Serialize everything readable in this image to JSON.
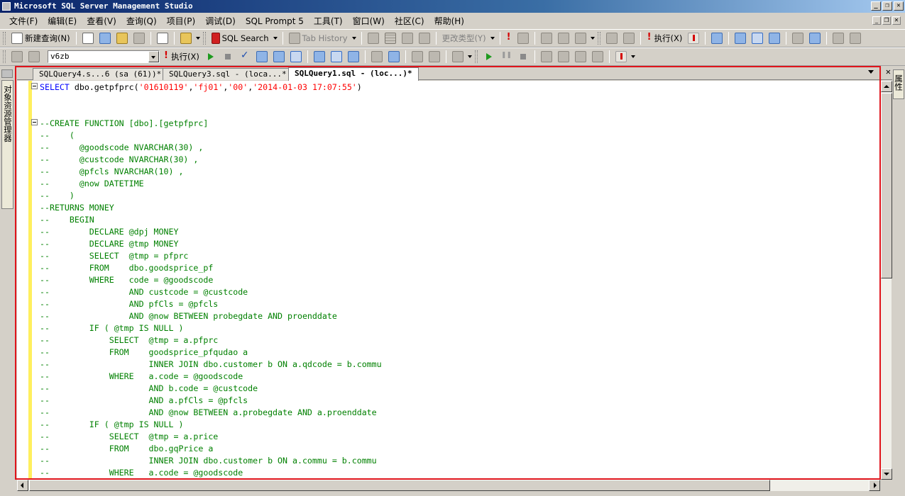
{
  "window": {
    "title": "Microsoft SQL Server Management Studio"
  },
  "menu": [
    "文件(F)",
    "编辑(E)",
    "查看(V)",
    "查询(Q)",
    "项目(P)",
    "调试(D)",
    "SQL Prompt 5",
    "工具(T)",
    "窗口(W)",
    "社区(C)",
    "帮助(H)"
  ],
  "toolbar1": {
    "new_query": "新建查询(N)",
    "sql_search": "SQL Search",
    "tab_history": "Tab History",
    "change_type": "更改类型(Y)",
    "execute": "执行(X)"
  },
  "toolbar2": {
    "database": "v6zb",
    "execute": "执行(X)"
  },
  "side_panels": {
    "left": "对象资源管理器",
    "right": "属性"
  },
  "tabs": [
    {
      "label": "SQLQuery4.s...6 (sa (61))*",
      "active": false
    },
    {
      "label": "SQLQuery3.sql - (loca...*",
      "active": false
    },
    {
      "label": "SQLQuery1.sql - (loc...)*",
      "active": true
    }
  ],
  "editor": {
    "lines": [
      "SELECT dbo.getpfprc('01610119','fj01','00','2014-01-03 17:07:55')",
      "",
      "",
      "--CREATE FUNCTION [dbo].[getpfprc]",
      "--    (",
      "--      @goodscode NVARCHAR(30) ,",
      "--      @custcode NVARCHAR(30) ,",
      "--      @pfcls NVARCHAR(10) ,",
      "--      @now DATETIME",
      "--    )",
      "--RETURNS MONEY",
      "--    BEGIN",
      "--        DECLARE @dpj MONEY",
      "--        DECLARE @tmp MONEY",
      "--        SELECT  @tmp = pfprc",
      "--        FROM    dbo.goodsprice_pf",
      "--        WHERE   code = @goodscode",
      "--                AND custcode = @custcode",
      "--                AND pfCls = @pfcls",
      "--                AND @now BETWEEN probegdate AND proenddate",
      "--        IF ( @tmp IS NULL )",
      "--            SELECT  @tmp = a.pfprc",
      "--            FROM    goodsprice_pfqudao a",
      "--                    INNER JOIN dbo.customer b ON a.qdcode = b.commu",
      "--            WHERE   a.code = @goodscode",
      "--                    AND b.code = @custcode",
      "--                    AND a.pfCls = @pfcls",
      "--                    AND @now BETWEEN a.probegdate AND a.proenddate",
      "--        IF ( @tmp IS NULL )",
      "--            SELECT  @tmp = a.price",
      "--            FROM    dbo.gqPrice a",
      "--                    INNER JOIN dbo.customer b ON a.commu = b.commu",
      "--            WHERE   a.code = @goodscode"
    ]
  },
  "colors": {
    "keyword": "#0000ff",
    "comment": "#008000",
    "string": "#ff0000",
    "highlight_box": "#e0141b",
    "title_gradient_start": "#0a246a"
  }
}
